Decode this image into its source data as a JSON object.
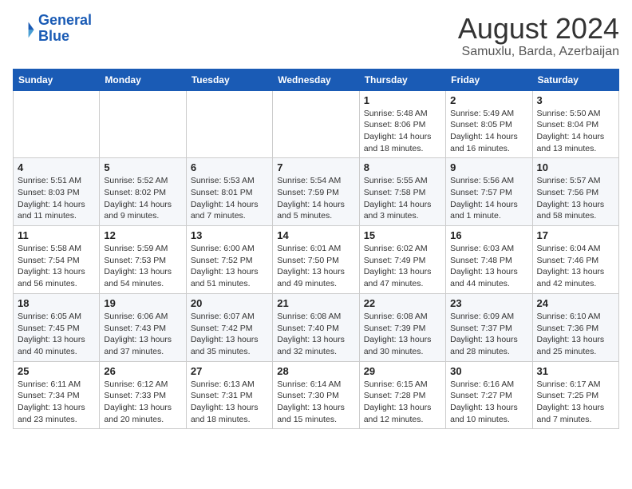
{
  "header": {
    "logo_line1": "General",
    "logo_line2": "Blue",
    "month_title": "August 2024",
    "location": "Samuxlu, Barda, Azerbaijan"
  },
  "weekdays": [
    "Sunday",
    "Monday",
    "Tuesday",
    "Wednesday",
    "Thursday",
    "Friday",
    "Saturday"
  ],
  "weeks": [
    [
      {
        "day": "",
        "info": ""
      },
      {
        "day": "",
        "info": ""
      },
      {
        "day": "",
        "info": ""
      },
      {
        "day": "",
        "info": ""
      },
      {
        "day": "1",
        "info": "Sunrise: 5:48 AM\nSunset: 8:06 PM\nDaylight: 14 hours\nand 18 minutes."
      },
      {
        "day": "2",
        "info": "Sunrise: 5:49 AM\nSunset: 8:05 PM\nDaylight: 14 hours\nand 16 minutes."
      },
      {
        "day": "3",
        "info": "Sunrise: 5:50 AM\nSunset: 8:04 PM\nDaylight: 14 hours\nand 13 minutes."
      }
    ],
    [
      {
        "day": "4",
        "info": "Sunrise: 5:51 AM\nSunset: 8:03 PM\nDaylight: 14 hours\nand 11 minutes."
      },
      {
        "day": "5",
        "info": "Sunrise: 5:52 AM\nSunset: 8:02 PM\nDaylight: 14 hours\nand 9 minutes."
      },
      {
        "day": "6",
        "info": "Sunrise: 5:53 AM\nSunset: 8:01 PM\nDaylight: 14 hours\nand 7 minutes."
      },
      {
        "day": "7",
        "info": "Sunrise: 5:54 AM\nSunset: 7:59 PM\nDaylight: 14 hours\nand 5 minutes."
      },
      {
        "day": "8",
        "info": "Sunrise: 5:55 AM\nSunset: 7:58 PM\nDaylight: 14 hours\nand 3 minutes."
      },
      {
        "day": "9",
        "info": "Sunrise: 5:56 AM\nSunset: 7:57 PM\nDaylight: 14 hours\nand 1 minute."
      },
      {
        "day": "10",
        "info": "Sunrise: 5:57 AM\nSunset: 7:56 PM\nDaylight: 13 hours\nand 58 minutes."
      }
    ],
    [
      {
        "day": "11",
        "info": "Sunrise: 5:58 AM\nSunset: 7:54 PM\nDaylight: 13 hours\nand 56 minutes."
      },
      {
        "day": "12",
        "info": "Sunrise: 5:59 AM\nSunset: 7:53 PM\nDaylight: 13 hours\nand 54 minutes."
      },
      {
        "day": "13",
        "info": "Sunrise: 6:00 AM\nSunset: 7:52 PM\nDaylight: 13 hours\nand 51 minutes."
      },
      {
        "day": "14",
        "info": "Sunrise: 6:01 AM\nSunset: 7:50 PM\nDaylight: 13 hours\nand 49 minutes."
      },
      {
        "day": "15",
        "info": "Sunrise: 6:02 AM\nSunset: 7:49 PM\nDaylight: 13 hours\nand 47 minutes."
      },
      {
        "day": "16",
        "info": "Sunrise: 6:03 AM\nSunset: 7:48 PM\nDaylight: 13 hours\nand 44 minutes."
      },
      {
        "day": "17",
        "info": "Sunrise: 6:04 AM\nSunset: 7:46 PM\nDaylight: 13 hours\nand 42 minutes."
      }
    ],
    [
      {
        "day": "18",
        "info": "Sunrise: 6:05 AM\nSunset: 7:45 PM\nDaylight: 13 hours\nand 40 minutes."
      },
      {
        "day": "19",
        "info": "Sunrise: 6:06 AM\nSunset: 7:43 PM\nDaylight: 13 hours\nand 37 minutes."
      },
      {
        "day": "20",
        "info": "Sunrise: 6:07 AM\nSunset: 7:42 PM\nDaylight: 13 hours\nand 35 minutes."
      },
      {
        "day": "21",
        "info": "Sunrise: 6:08 AM\nSunset: 7:40 PM\nDaylight: 13 hours\nand 32 minutes."
      },
      {
        "day": "22",
        "info": "Sunrise: 6:08 AM\nSunset: 7:39 PM\nDaylight: 13 hours\nand 30 minutes."
      },
      {
        "day": "23",
        "info": "Sunrise: 6:09 AM\nSunset: 7:37 PM\nDaylight: 13 hours\nand 28 minutes."
      },
      {
        "day": "24",
        "info": "Sunrise: 6:10 AM\nSunset: 7:36 PM\nDaylight: 13 hours\nand 25 minutes."
      }
    ],
    [
      {
        "day": "25",
        "info": "Sunrise: 6:11 AM\nSunset: 7:34 PM\nDaylight: 13 hours\nand 23 minutes."
      },
      {
        "day": "26",
        "info": "Sunrise: 6:12 AM\nSunset: 7:33 PM\nDaylight: 13 hours\nand 20 minutes."
      },
      {
        "day": "27",
        "info": "Sunrise: 6:13 AM\nSunset: 7:31 PM\nDaylight: 13 hours\nand 18 minutes."
      },
      {
        "day": "28",
        "info": "Sunrise: 6:14 AM\nSunset: 7:30 PM\nDaylight: 13 hours\nand 15 minutes."
      },
      {
        "day": "29",
        "info": "Sunrise: 6:15 AM\nSunset: 7:28 PM\nDaylight: 13 hours\nand 12 minutes."
      },
      {
        "day": "30",
        "info": "Sunrise: 6:16 AM\nSunset: 7:27 PM\nDaylight: 13 hours\nand 10 minutes."
      },
      {
        "day": "31",
        "info": "Sunrise: 6:17 AM\nSunset: 7:25 PM\nDaylight: 13 hours\nand 7 minutes."
      }
    ]
  ]
}
